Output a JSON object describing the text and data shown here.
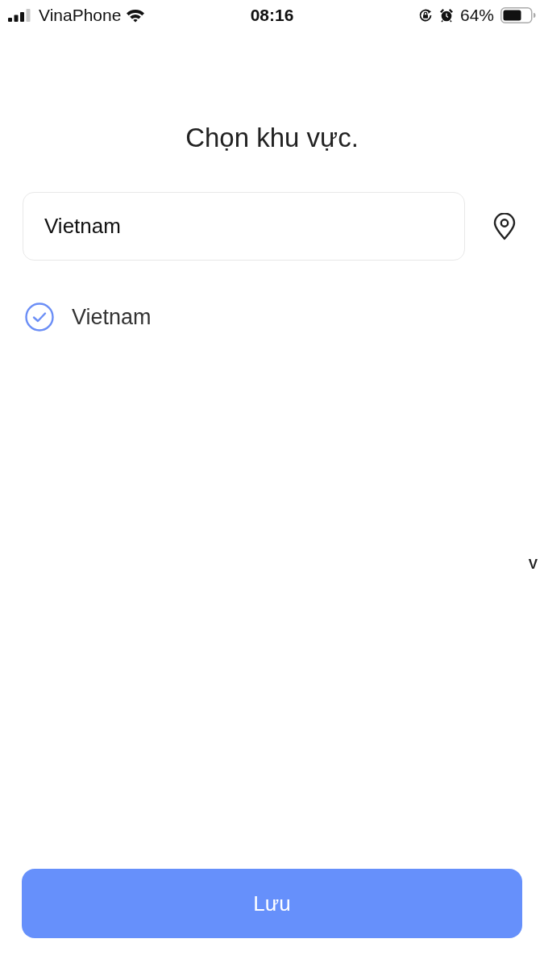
{
  "status_bar": {
    "carrier": "VinaPhone",
    "time": "08:16",
    "battery_percent": "64%"
  },
  "title": "Chọn khu vực.",
  "search": {
    "value": "Vietnam"
  },
  "results": [
    {
      "label": "Vietnam",
      "selected": true
    }
  ],
  "index_letters": [
    "V"
  ],
  "save_button": {
    "label": "Lưu"
  }
}
